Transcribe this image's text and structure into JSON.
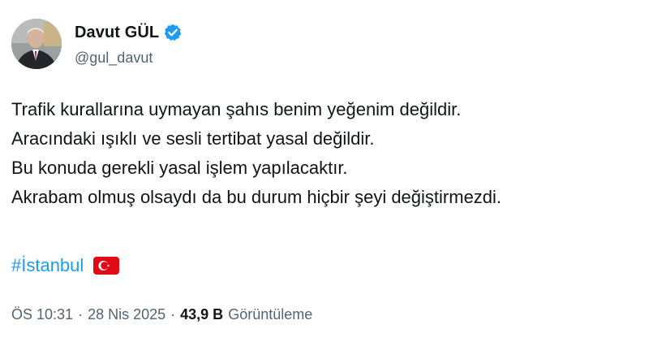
{
  "author": {
    "display_name": "Davut GÜL",
    "handle": "@gul_davut",
    "verified": true,
    "verified_color": "#1d9bf0",
    "avatar_icon": "profile-photo"
  },
  "tweet": {
    "lines": [
      "Trafik kurallarına uymayan şahıs benim yeğenim değildir.",
      "Aracındaki ışıklı ve sesli tertibat yasal değildir.",
      "Bu konuda gerekli yasal işlem yapılacaktır.",
      "Akrabam olmuş olsaydı da bu durum hiçbir şeyi değiştirmezdi."
    ],
    "hashtag": "#İstanbul",
    "hashtag_color": "#1d9bf0",
    "flag_icon": "turkey-flag-icon"
  },
  "meta": {
    "time": "ÖS 10:31",
    "date": "28 Nis 2025",
    "separator": "·",
    "views_count": "43,9 B",
    "views_label": "Görüntüleme"
  }
}
